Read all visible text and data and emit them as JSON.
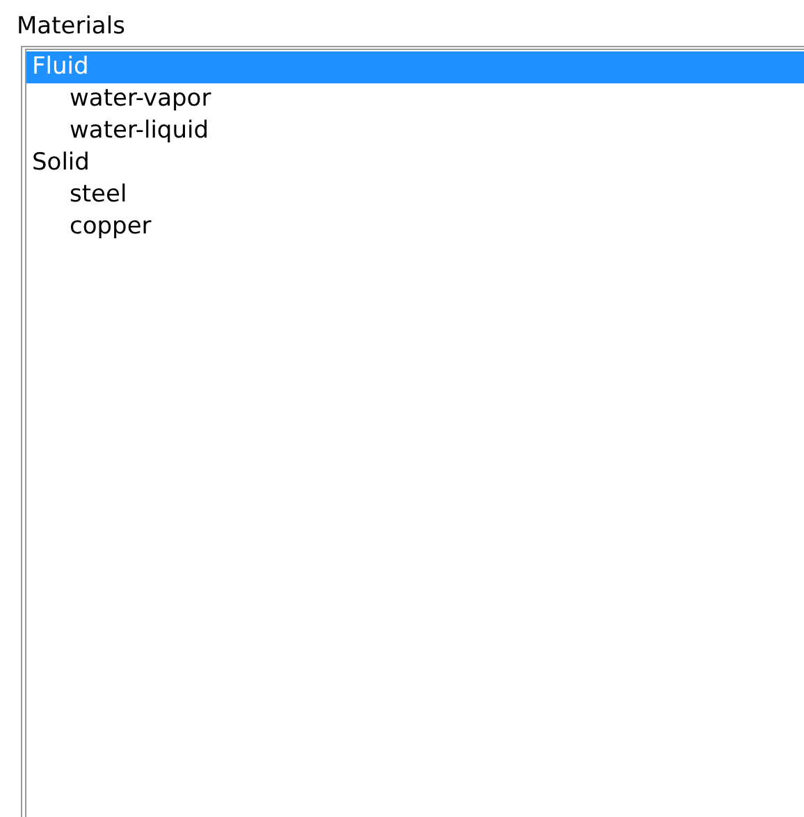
{
  "label": "Materials",
  "tree": [
    {
      "label": "Fluid",
      "selected": true,
      "children": [
        {
          "label": "water-vapor",
          "selected": false
        },
        {
          "label": "water-liquid",
          "selected": false
        }
      ]
    },
    {
      "label": "Solid",
      "selected": false,
      "children": [
        {
          "label": "steel",
          "selected": false
        },
        {
          "label": "copper",
          "selected": false
        }
      ]
    }
  ]
}
